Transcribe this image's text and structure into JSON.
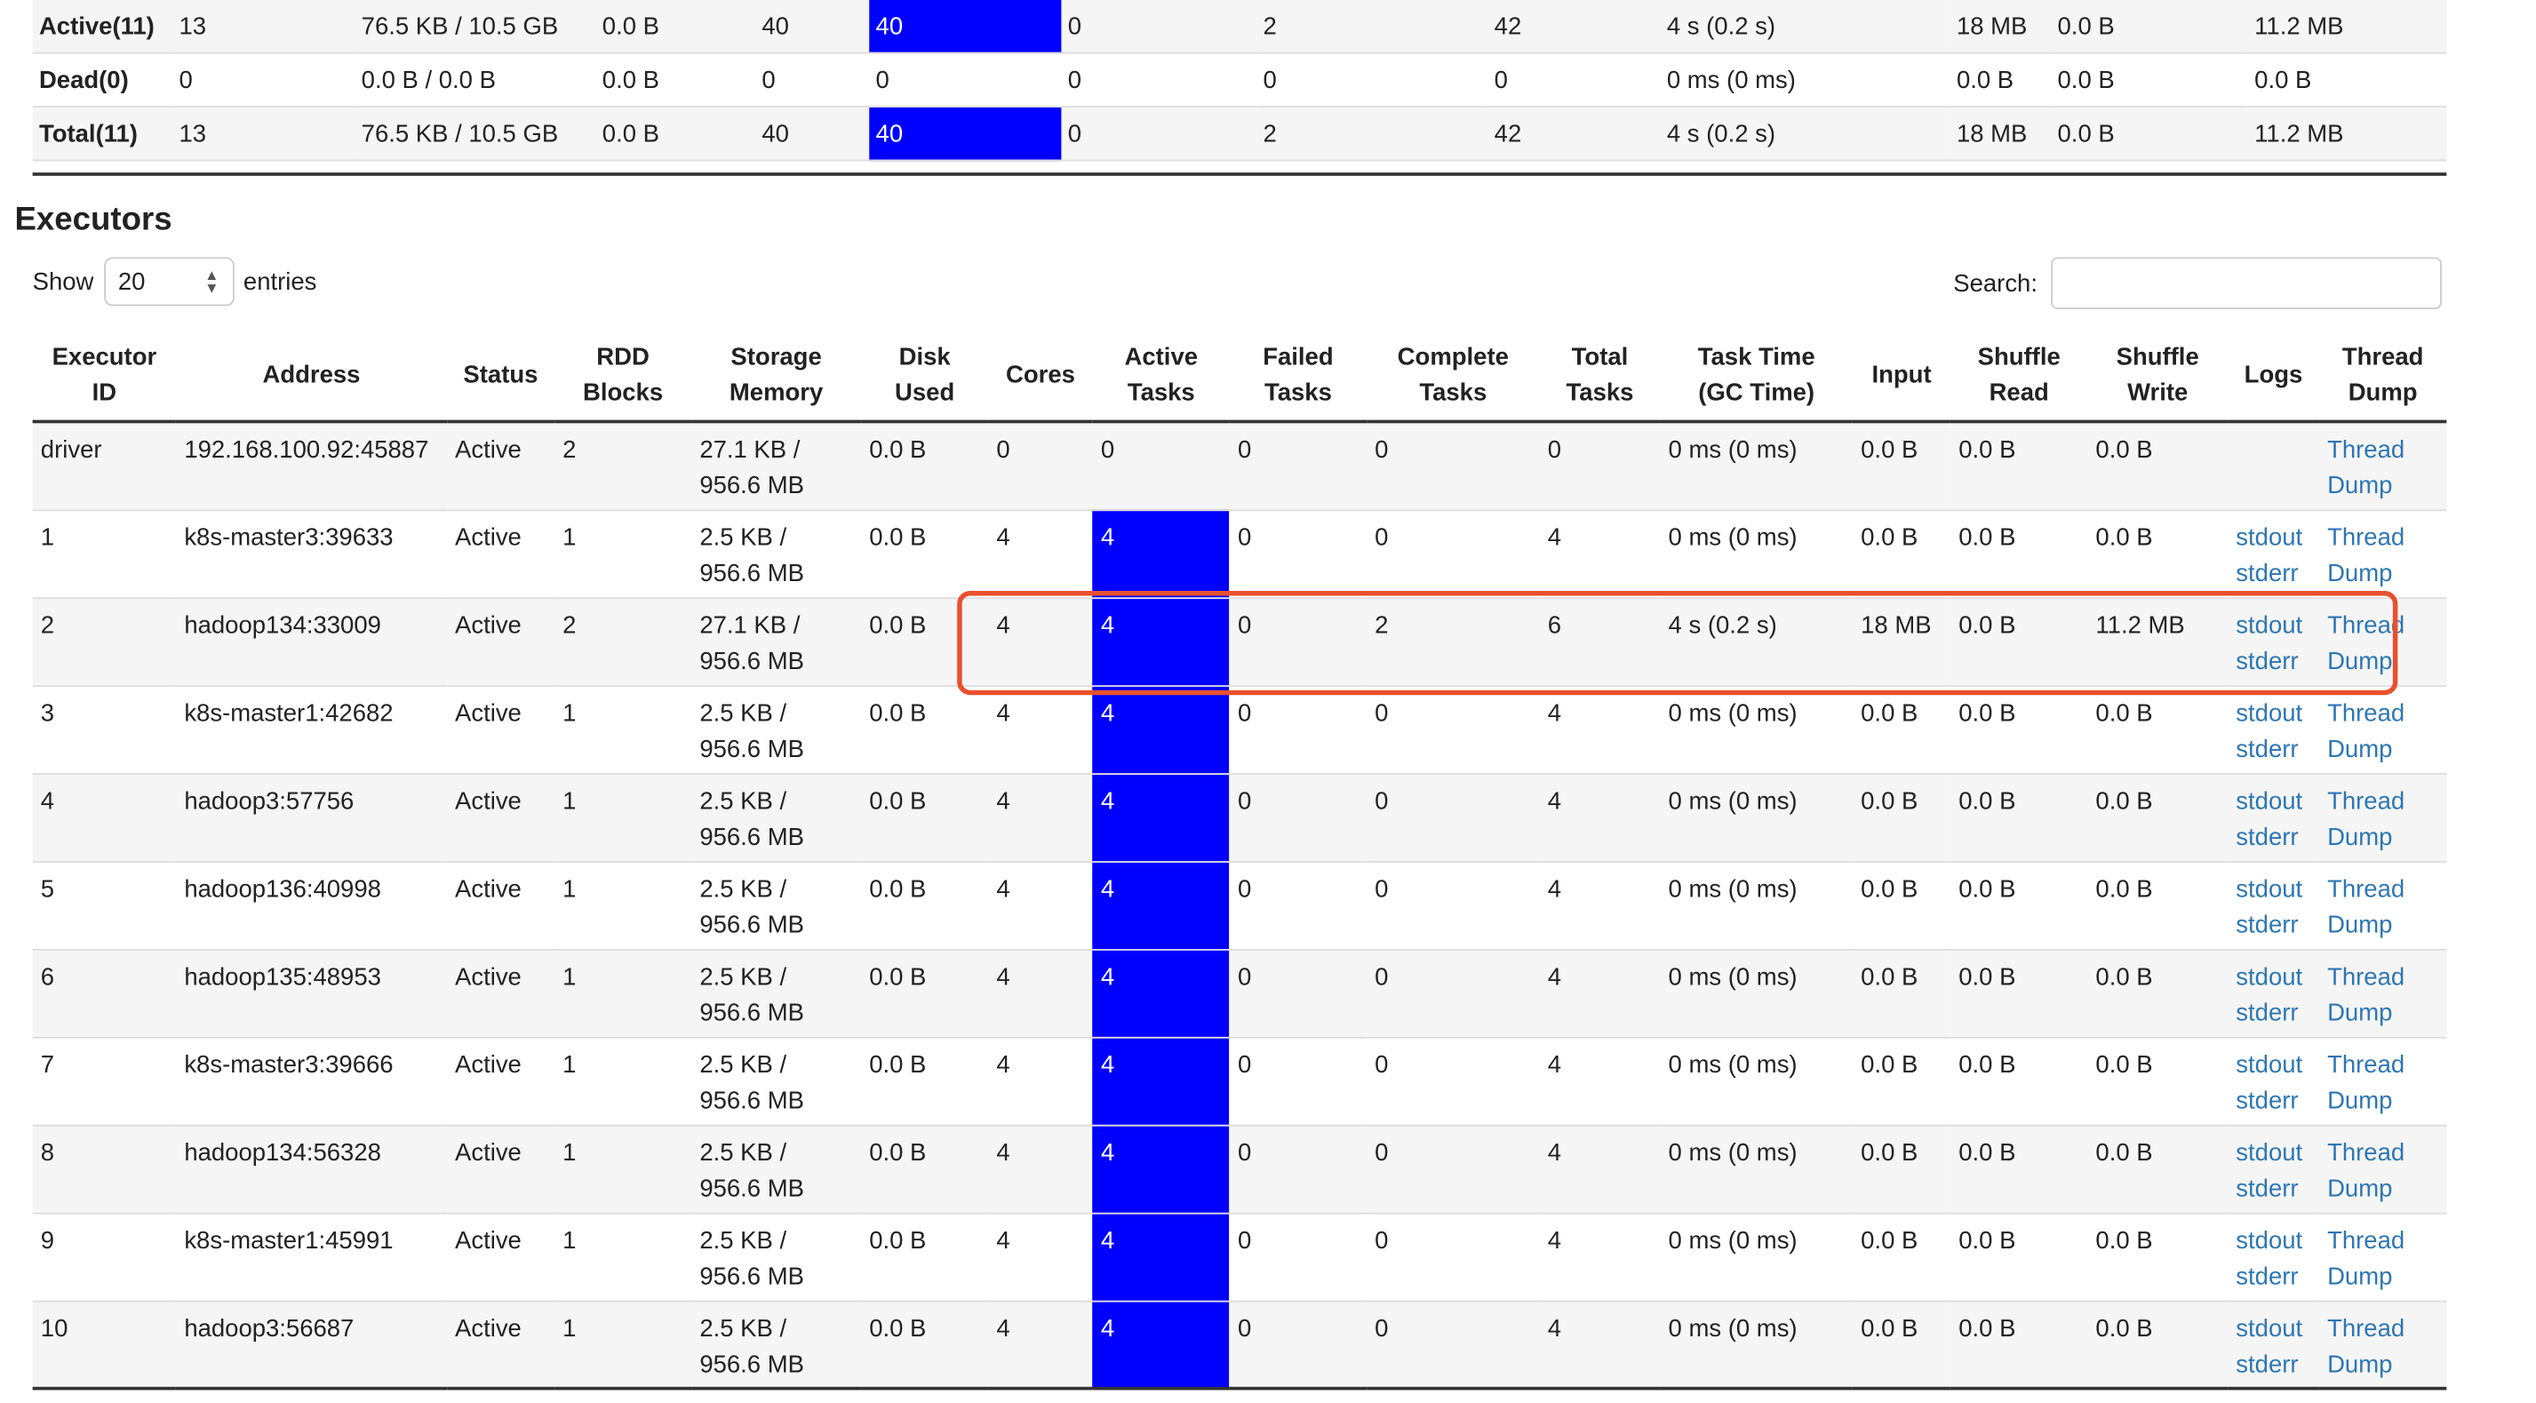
{
  "summary": {
    "rows": [
      {
        "label": "Active(11)",
        "cells": [
          "13",
          "76.5 KB / 10.5 GB",
          "0.0 B",
          "40",
          "40",
          "0",
          "2",
          "42",
          "4 s (0.2 s)",
          "18 MB",
          "0.0 B",
          "11.2 MB"
        ]
      },
      {
        "label": "Dead(0)",
        "cells": [
          "0",
          "0.0 B / 0.0 B",
          "0.0 B",
          "0",
          "0",
          "0",
          "0",
          "0",
          "0 ms (0 ms)",
          "0.0 B",
          "0.0 B",
          "0.0 B"
        ]
      },
      {
        "label": "Total(11)",
        "cells": [
          "13",
          "76.5 KB / 10.5 GB",
          "0.0 B",
          "40",
          "40",
          "0",
          "2",
          "42",
          "4 s (0.2 s)",
          "18 MB",
          "0.0 B",
          "11.2 MB"
        ]
      }
    ]
  },
  "executors": {
    "title": "Executors",
    "show_label": "Show",
    "entries_value": "20",
    "entries_label": "entries",
    "search_label": "Search:",
    "search_value": "",
    "headers": [
      [
        "Executor",
        "ID"
      ],
      [
        "",
        "Address"
      ],
      [
        "",
        "Status"
      ],
      [
        "RDD",
        "Blocks"
      ],
      [
        "Storage",
        "Memory"
      ],
      [
        "Disk",
        "Used"
      ],
      [
        "",
        "Cores"
      ],
      [
        "Active",
        "Tasks"
      ],
      [
        "Failed",
        "Tasks"
      ],
      [
        "Complete",
        "Tasks"
      ],
      [
        "Total",
        "Tasks"
      ],
      [
        "Task Time",
        "(GC Time)"
      ],
      [
        "",
        "Input"
      ],
      [
        "Shuffle",
        "Read"
      ],
      [
        "Shuffle",
        "Write"
      ],
      [
        "",
        "Logs"
      ],
      [
        "Thread",
        "Dump"
      ]
    ],
    "rows": [
      {
        "id": "driver",
        "address": "192.168.100.92:45887",
        "status": "Active",
        "rdd": "2",
        "mem1": "27.1 KB /",
        "mem2": "956.6 MB",
        "disk": "0.0 B",
        "cores": "0",
        "active": "0",
        "failed": "0",
        "complete": "0",
        "total": "0",
        "time": "0 ms (0 ms)",
        "input": "0.0 B",
        "sread": "0.0 B",
        "swrite": "0.0 B",
        "stdout": "",
        "stderr": "",
        "td1": "Thread",
        "td2": "Dump",
        "hl": false
      },
      {
        "id": "1",
        "address": "k8s-master3:39633",
        "status": "Active",
        "rdd": "1",
        "mem1": "2.5 KB /",
        "mem2": "956.6 MB",
        "disk": "0.0 B",
        "cores": "4",
        "active": "4",
        "failed": "0",
        "complete": "0",
        "total": "4",
        "time": "0 ms (0 ms)",
        "input": "0.0 B",
        "sread": "0.0 B",
        "swrite": "0.0 B",
        "stdout": "stdout",
        "stderr": "stderr",
        "td1": "Thread",
        "td2": "Dump",
        "hl": true
      },
      {
        "id": "2",
        "address": "hadoop134:33009",
        "status": "Active",
        "rdd": "2",
        "mem1": "27.1 KB /",
        "mem2": "956.6 MB",
        "disk": "0.0 B",
        "cores": "4",
        "active": "4",
        "failed": "0",
        "complete": "2",
        "total": "6",
        "time": "4 s (0.2 s)",
        "input": "18 MB",
        "sread": "0.0 B",
        "swrite": "11.2 MB",
        "stdout": "stdout",
        "stderr": "stderr",
        "td1": "Thread",
        "td2": "Dump",
        "hl": true
      },
      {
        "id": "3",
        "address": "k8s-master1:42682",
        "status": "Active",
        "rdd": "1",
        "mem1": "2.5 KB /",
        "mem2": "956.6 MB",
        "disk": "0.0 B",
        "cores": "4",
        "active": "4",
        "failed": "0",
        "complete": "0",
        "total": "4",
        "time": "0 ms (0 ms)",
        "input": "0.0 B",
        "sread": "0.0 B",
        "swrite": "0.0 B",
        "stdout": "stdout",
        "stderr": "stderr",
        "td1": "Thread",
        "td2": "Dump",
        "hl": true
      },
      {
        "id": "4",
        "address": "hadoop3:57756",
        "status": "Active",
        "rdd": "1",
        "mem1": "2.5 KB /",
        "mem2": "956.6 MB",
        "disk": "0.0 B",
        "cores": "4",
        "active": "4",
        "failed": "0",
        "complete": "0",
        "total": "4",
        "time": "0 ms (0 ms)",
        "input": "0.0 B",
        "sread": "0.0 B",
        "swrite": "0.0 B",
        "stdout": "stdout",
        "stderr": "stderr",
        "td1": "Thread",
        "td2": "Dump",
        "hl": true
      },
      {
        "id": "5",
        "address": "hadoop136:40998",
        "status": "Active",
        "rdd": "1",
        "mem1": "2.5 KB /",
        "mem2": "956.6 MB",
        "disk": "0.0 B",
        "cores": "4",
        "active": "4",
        "failed": "0",
        "complete": "0",
        "total": "4",
        "time": "0 ms (0 ms)",
        "input": "0.0 B",
        "sread": "0.0 B",
        "swrite": "0.0 B",
        "stdout": "stdout",
        "stderr": "stderr",
        "td1": "Thread",
        "td2": "Dump",
        "hl": true
      },
      {
        "id": "6",
        "address": "hadoop135:48953",
        "status": "Active",
        "rdd": "1",
        "mem1": "2.5 KB /",
        "mem2": "956.6 MB",
        "disk": "0.0 B",
        "cores": "4",
        "active": "4",
        "failed": "0",
        "complete": "0",
        "total": "4",
        "time": "0 ms (0 ms)",
        "input": "0.0 B",
        "sread": "0.0 B",
        "swrite": "0.0 B",
        "stdout": "stdout",
        "stderr": "stderr",
        "td1": "Thread",
        "td2": "Dump",
        "hl": true
      },
      {
        "id": "7",
        "address": "k8s-master3:39666",
        "status": "Active",
        "rdd": "1",
        "mem1": "2.5 KB /",
        "mem2": "956.6 MB",
        "disk": "0.0 B",
        "cores": "4",
        "active": "4",
        "failed": "0",
        "complete": "0",
        "total": "4",
        "time": "0 ms (0 ms)",
        "input": "0.0 B",
        "sread": "0.0 B",
        "swrite": "0.0 B",
        "stdout": "stdout",
        "stderr": "stderr",
        "td1": "Thread",
        "td2": "Dump",
        "hl": true
      },
      {
        "id": "8",
        "address": "hadoop134:56328",
        "status": "Active",
        "rdd": "1",
        "mem1": "2.5 KB /",
        "mem2": "956.6 MB",
        "disk": "0.0 B",
        "cores": "4",
        "active": "4",
        "failed": "0",
        "complete": "0",
        "total": "4",
        "time": "0 ms (0 ms)",
        "input": "0.0 B",
        "sread": "0.0 B",
        "swrite": "0.0 B",
        "stdout": "stdout",
        "stderr": "stderr",
        "td1": "Thread",
        "td2": "Dump",
        "hl": true
      },
      {
        "id": "9",
        "address": "k8s-master1:45991",
        "status": "Active",
        "rdd": "1",
        "mem1": "2.5 KB /",
        "mem2": "956.6 MB",
        "disk": "0.0 B",
        "cores": "4",
        "active": "4",
        "failed": "0",
        "complete": "0",
        "total": "4",
        "time": "0 ms (0 ms)",
        "input": "0.0 B",
        "sread": "0.0 B",
        "swrite": "0.0 B",
        "stdout": "stdout",
        "stderr": "stderr",
        "td1": "Thread",
        "td2": "Dump",
        "hl": true
      },
      {
        "id": "10",
        "address": "hadoop3:56687",
        "status": "Active",
        "rdd": "1",
        "mem1": "2.5 KB /",
        "mem2": "956.6 MB",
        "disk": "0.0 B",
        "cores": "4",
        "active": "4",
        "failed": "0",
        "complete": "0",
        "total": "4",
        "time": "0 ms (0 ms)",
        "input": "0.0 B",
        "sread": "0.0 B",
        "swrite": "0.0 B",
        "stdout": "stdout",
        "stderr": "stderr",
        "td1": "Thread",
        "td2": "Dump",
        "hl": true
      }
    ]
  },
  "colors": {
    "active_task_highlight": "#0000ff",
    "link": "#2d76b4",
    "annotation_box": "#e8512f"
  }
}
